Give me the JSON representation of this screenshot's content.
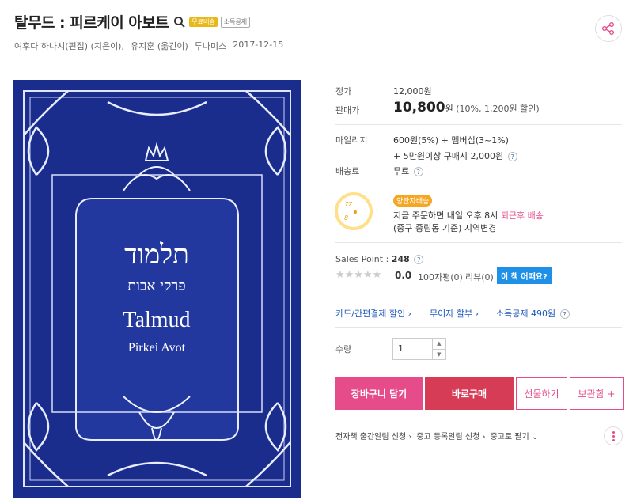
{
  "title": "탈무드 : 피르케이 아보트",
  "badges": {
    "free_shipping": "무료배송",
    "tax_deduction": "소득공제"
  },
  "meta": {
    "authors": "여후다 하나시(편집) (지은이),",
    "translator": "유지훈 (옮긴이)",
    "publisher": "투나미스",
    "date": "2017-12-15"
  },
  "cover": {
    "hebrew_title": "תלמוד",
    "hebrew_subtitle": "פרקי אבות",
    "english_title": "Talmud",
    "english_subtitle": "Pirkei Avot",
    "bg_color": "#1a2c8a"
  },
  "price": {
    "list_label": "정가",
    "list_value": "12,000원",
    "sale_label": "판매가",
    "sale_value": "10,800",
    "sale_unit": "원",
    "discount": "(10%, 1,200원 할인)"
  },
  "mileage": {
    "label": "마일리지",
    "line1": "600원(5%) + 멤버십(3~1%)",
    "line2": "+ 5만원이상 구매시 2,000원"
  },
  "shipping": {
    "label": "배송료",
    "value": "무료"
  },
  "delivery": {
    "badge": "양탄자배송",
    "line1_prefix": "지금 주문하면 내일 오후 8시",
    "line1_highlight": "퇴근후 배송",
    "line2": "(중구 중림동 기준) 지역변경",
    "clock_label": "8",
    "clock_top": "77"
  },
  "sales_point": {
    "label": "Sales Point :",
    "value": "248"
  },
  "rating": {
    "score": "0.0",
    "reviews_100": "100자평(0)",
    "reviews": "리뷰(0)",
    "book_tag": "이 책 어때요?",
    "stars": 0
  },
  "benefits": {
    "card": "카드/간편결제 할인",
    "installment": "무이자 할부",
    "tax": "소득공제 490원"
  },
  "quantity": {
    "label": "수량",
    "value": "1"
  },
  "buttons": {
    "cart": "장바구니 담기",
    "buy": "바로구매",
    "gift": "선물하기",
    "keep": "보관함 +"
  },
  "alerts": {
    "ebook": "전자책 출간알림 신청",
    "used_alert": "중고 등록알림 신청",
    "sell_used": "중고로 팔기"
  },
  "colors": {
    "accent": "#e64c8a",
    "buy": "#d63c55",
    "link": "#1a56b8"
  }
}
